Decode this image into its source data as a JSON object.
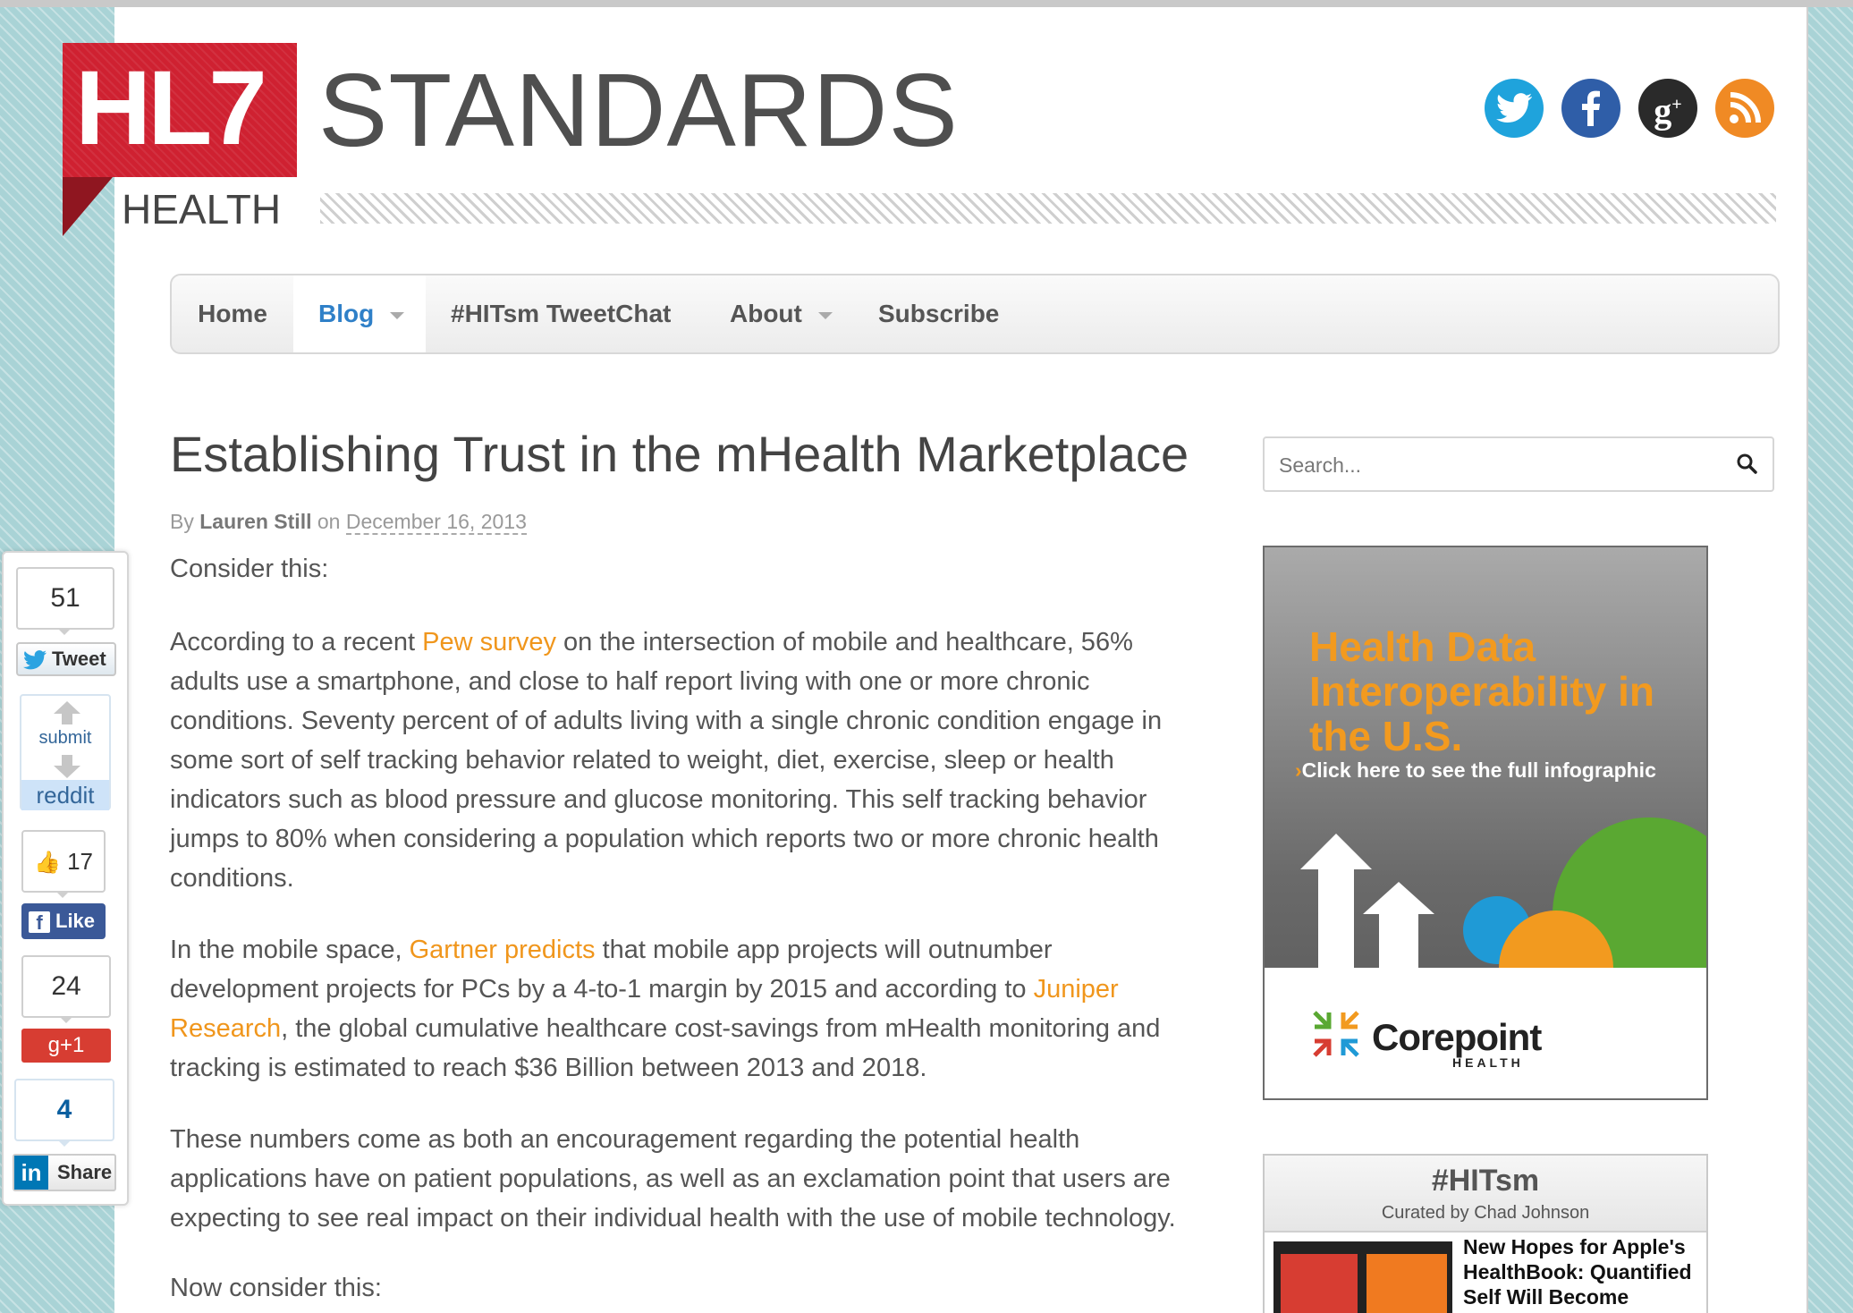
{
  "logo": {
    "mark": "HL7",
    "wordmark": "STANDARDS",
    "sub": "HEALTH"
  },
  "social": [
    {
      "name": "twitter",
      "icon": "twitter-icon",
      "color": "#1fa3dc"
    },
    {
      "name": "facebook",
      "icon": "facebook-icon",
      "color": "#2f5ea8"
    },
    {
      "name": "google-plus",
      "icon": "google-plus-icon",
      "color": "#2a2a2a"
    },
    {
      "name": "rss",
      "icon": "rss-icon",
      "color": "#f08a24"
    }
  ],
  "nav": {
    "items": [
      {
        "label": "Home"
      },
      {
        "label": "Blog"
      },
      {
        "label": "#HITsm TweetChat"
      },
      {
        "label": "About"
      },
      {
        "label": "Subscribe"
      }
    ]
  },
  "article": {
    "title": "Establishing Trust in the mHealth Marketplace",
    "by": "By",
    "author": "Lauren Still",
    "on": "on",
    "date": "December 16, 2013",
    "p1": "Consider this:",
    "p2_a": "According to a recent ",
    "p2_link": "Pew survey",
    "p2_b": " on the intersection of mobile and healthcare, 56% adults use a smartphone, and close to half report living with one or more chronic conditions. Seventy percent of of adults living with a single chronic condition engage in some sort of self tracking behavior related to weight, diet, exercise, sleep or health indicators such as blood pressure and glucose monitoring. This self tracking behavior jumps to 80% when considering a population which reports two or more chronic health conditions.",
    "p3_a": "In the mobile space, ",
    "p3_link1": "Gartner predicts",
    "p3_b": " that mobile app projects will outnumber development projects for PCs by a 4-to-1 margin by 2015 and according to ",
    "p3_link2": "Juniper Research",
    "p3_c": ", the global cumulative healthcare cost-savings from mHealth monitoring and tracking is estimated to reach $36 Billion between 2013 and 2018.",
    "p4": "These numbers come as both an encouragement regarding the potential health applications have on patient populations, as well as an exclamation point that users are expecting to see real impact on their individual health with the use of mobile technology.",
    "p5": "Now consider this:"
  },
  "search": {
    "placeholder": "Search..."
  },
  "ad": {
    "title": "Health Data Interoperability in the U.S.",
    "cta": "Click here to see the full infographic",
    "brand": "Corepoint",
    "brand_sub": "HEALTH"
  },
  "hitsm": {
    "title": "#HITsm",
    "curated": "Curated by Chad Johnson",
    "headline": "New Hopes for Apple's HealthBook: Quantified Self Will Become Medicine"
  },
  "share": {
    "tweet_count": "51",
    "tweet_label": "Tweet",
    "reddit_submit": "submit",
    "reddit_label": "reddit",
    "like_count": "17",
    "like_label": "Like",
    "gplus_count": "24",
    "gplus_label": "g+1",
    "linkedin_count": "4",
    "linkedin_label": "Share"
  },
  "colors": {
    "accent_link": "#f0961c",
    "nav_active": "#2f80c8",
    "logo_red": "#cf2131"
  }
}
